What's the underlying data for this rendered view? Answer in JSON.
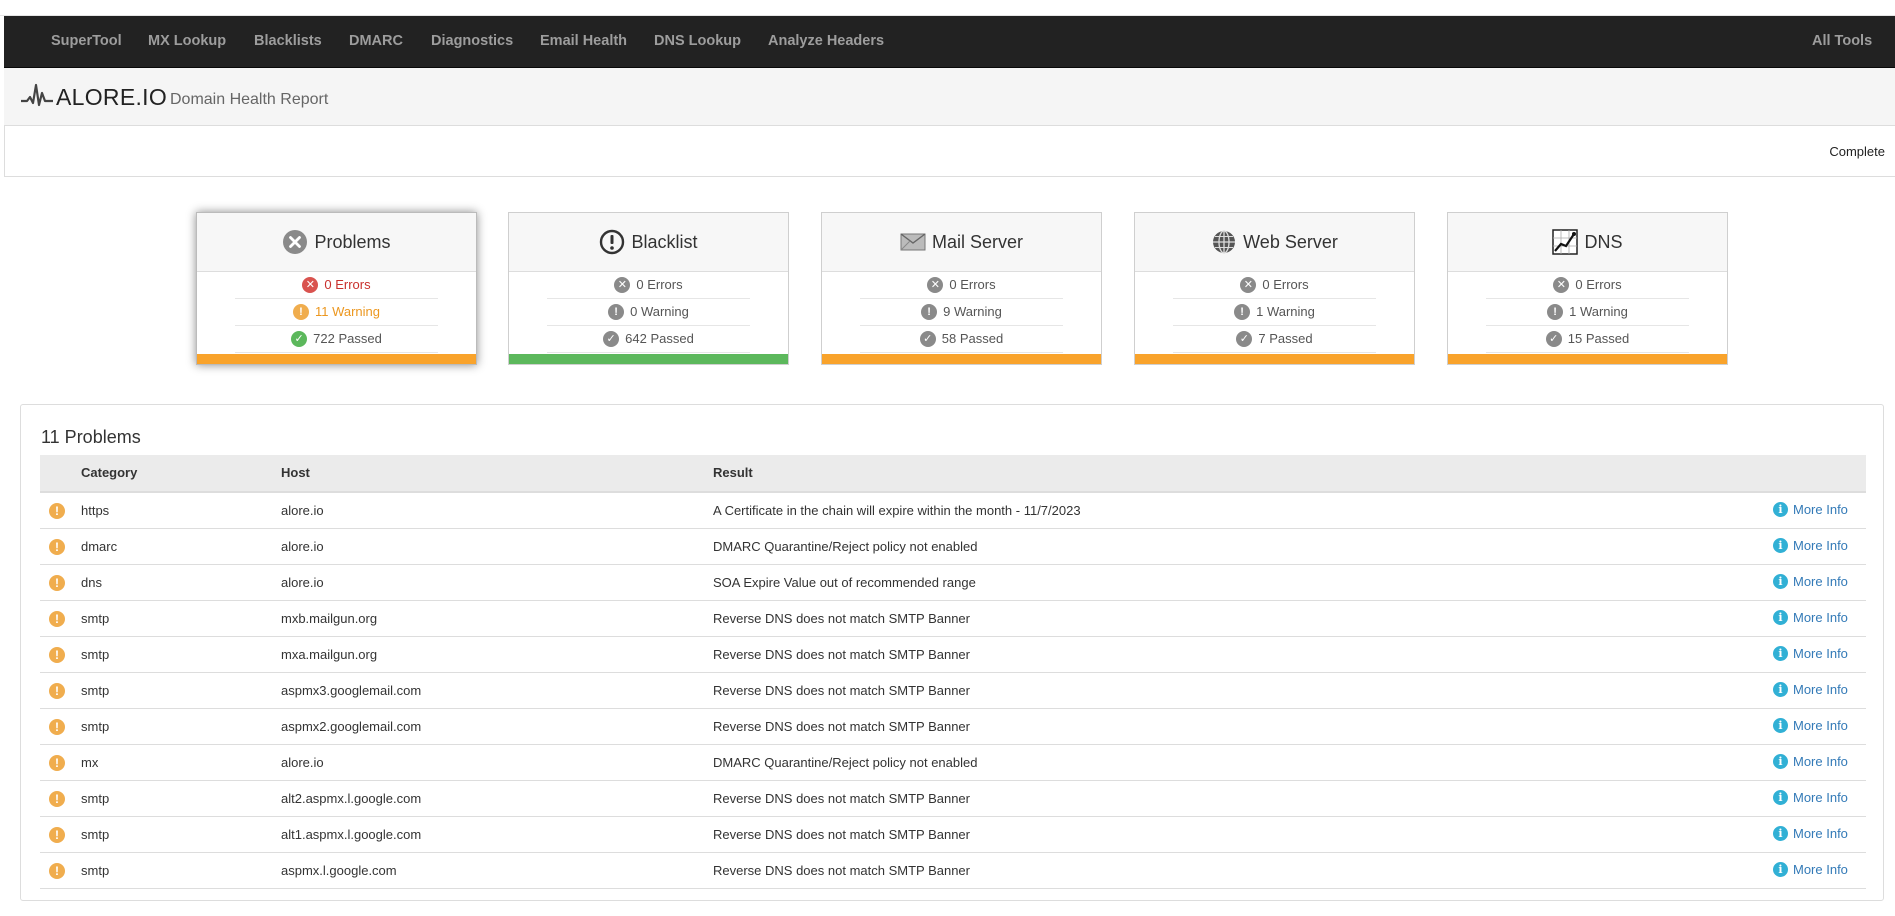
{
  "nav": {
    "items": [
      "SuperTool",
      "MX Lookup",
      "Blacklists",
      "DMARC",
      "Diagnostics",
      "Email Health",
      "DNS Lookup",
      "Analyze Headers"
    ],
    "right": "All Tools"
  },
  "header": {
    "brand": "ALORE.IO",
    "subtitle": "Domain Health Report"
  },
  "status": "Complete",
  "cards": [
    {
      "title": "Problems",
      "icon": "x-circle-icon",
      "errors": "0 Errors",
      "warning": "11 Warning",
      "passed": "722 Passed",
      "bar_color": "#f9a32b"
    },
    {
      "title": "Blacklist",
      "icon": "exclamation-circle-icon",
      "errors": "0 Errors",
      "warning": "0 Warning",
      "passed": "642 Passed",
      "bar_color": "#5cb85c"
    },
    {
      "title": "Mail Server",
      "icon": "envelope-icon",
      "errors": "0 Errors",
      "warning": "9 Warning",
      "passed": "58 Passed",
      "bar_color": "#f9a32b"
    },
    {
      "title": "Web Server",
      "icon": "globe-icon",
      "errors": "0 Errors",
      "warning": "1 Warning",
      "passed": "7 Passed",
      "bar_color": "#f9a32b"
    },
    {
      "title": "DNS",
      "icon": "chart-icon",
      "errors": "0 Errors",
      "warning": "1 Warning",
      "passed": "15 Passed",
      "bar_color": "#f9a32b"
    }
  ],
  "problems": {
    "title": "11 Problems",
    "columns": {
      "category": "Category",
      "host": "Host",
      "result": "Result"
    },
    "more_info": "More Info",
    "rows": [
      {
        "category": "https",
        "host": "alore.io",
        "result": "A Certificate in the chain will expire within the month - 11/7/2023"
      },
      {
        "category": "dmarc",
        "host": "alore.io",
        "result": "DMARC Quarantine/Reject policy not enabled"
      },
      {
        "category": "dns",
        "host": "alore.io",
        "result": "SOA Expire Value out of recommended range"
      },
      {
        "category": "smtp",
        "host": "mxb.mailgun.org",
        "result": "Reverse DNS does not match SMTP Banner"
      },
      {
        "category": "smtp",
        "host": "mxa.mailgun.org",
        "result": "Reverse DNS does not match SMTP Banner"
      },
      {
        "category": "smtp",
        "host": "aspmx3.googlemail.com",
        "result": "Reverse DNS does not match SMTP Banner"
      },
      {
        "category": "smtp",
        "host": "aspmx2.googlemail.com",
        "result": "Reverse DNS does not match SMTP Banner"
      },
      {
        "category": "mx",
        "host": "alore.io",
        "result": "DMARC Quarantine/Reject policy not enabled"
      },
      {
        "category": "smtp",
        "host": "alt2.aspmx.l.google.com",
        "result": "Reverse DNS does not match SMTP Banner"
      },
      {
        "category": "smtp",
        "host": "alt1.aspmx.l.google.com",
        "result": "Reverse DNS does not match SMTP Banner"
      },
      {
        "category": "smtp",
        "host": "aspmx.l.google.com",
        "result": "Reverse DNS does not match SMTP Banner"
      }
    ]
  }
}
